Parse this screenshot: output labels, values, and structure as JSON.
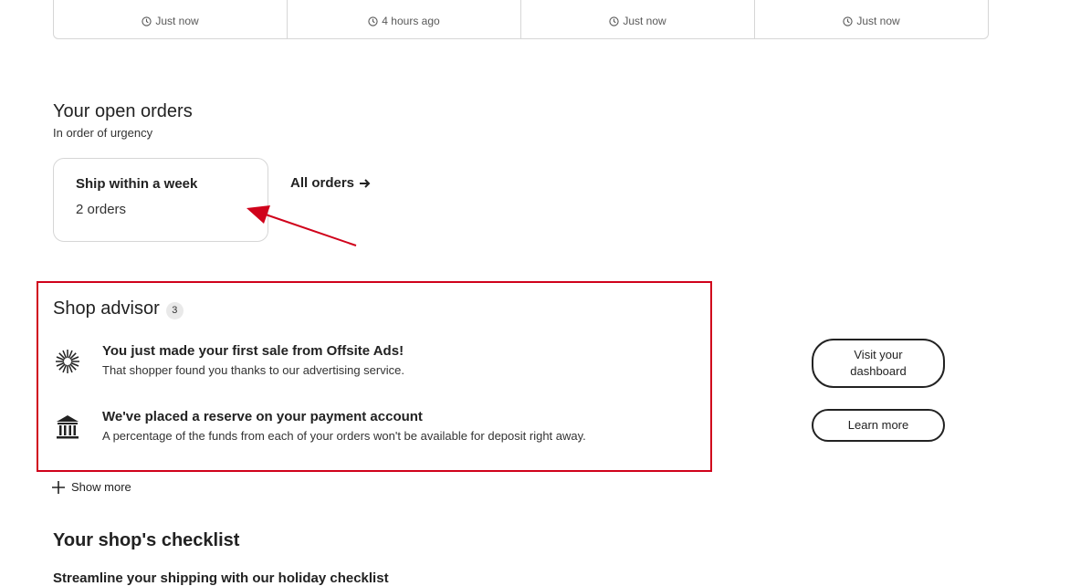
{
  "activity": {
    "cells": [
      {
        "time": "Just now"
      },
      {
        "time": "4 hours ago"
      },
      {
        "time": "Just now"
      },
      {
        "time": "Just now"
      }
    ]
  },
  "open_orders": {
    "title": "Your open orders",
    "subtitle": "In order of urgency",
    "card": {
      "title": "Ship within a week",
      "count": "2 orders"
    },
    "all_orders_label": "All orders"
  },
  "shop_advisor": {
    "title": "Shop advisor",
    "count": "3",
    "items": [
      {
        "icon": "sparkle-icon",
        "title": "You just made your first sale from Offsite Ads!",
        "description": "That shopper found you thanks to our advertising service.",
        "button": "Visit your dashboard"
      },
      {
        "icon": "bank-icon",
        "title": "We've placed a reserve on your payment account",
        "description": "A percentage of the funds from each of your orders won't be available for deposit right away.",
        "button": "Learn more"
      }
    ],
    "show_more_label": "Show more"
  },
  "checklist": {
    "title": "Your shop's checklist",
    "first_item": "Streamline your shipping with our holiday checklist"
  },
  "colors": {
    "highlight": "#d0021b",
    "text": "#222222",
    "border": "#d6d6d6"
  }
}
